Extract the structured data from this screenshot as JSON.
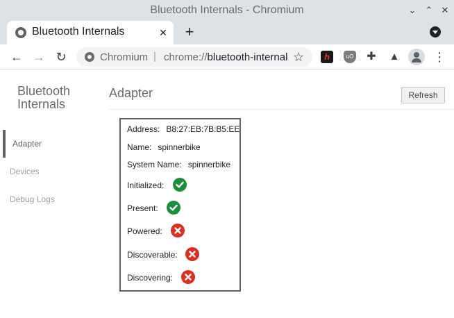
{
  "window": {
    "title": "Bluetooth Internals - Chromium"
  },
  "tab": {
    "title": "Bluetooth Internals"
  },
  "omnibox": {
    "origin": "Chromium",
    "separator": "|",
    "scheme": "chrome://",
    "url_rest": "bluetooth-internal..."
  },
  "extensions": {
    "h_label": "h",
    "ub_label": "uO"
  },
  "sidebar": {
    "title": "Bluetooth Internals",
    "items": [
      {
        "label": "Adapter",
        "selected": true
      },
      {
        "label": "Devices",
        "selected": false
      },
      {
        "label": "Debug Logs",
        "selected": false
      }
    ]
  },
  "main": {
    "heading": "Adapter",
    "refresh_label": "Refresh"
  },
  "adapter": {
    "address_label": "Address:",
    "address_value": "B8:27:EB:7B:B5:EE",
    "name_label": "Name:",
    "name_value": "spinnerbike",
    "system_name_label": "System Name:",
    "system_name_value": "spinnerbike",
    "flags": [
      {
        "label": "Initialized:",
        "value": true
      },
      {
        "label": "Present:",
        "value": true
      },
      {
        "label": "Powered:",
        "value": false
      },
      {
        "label": "Discoverable:",
        "value": false
      },
      {
        "label": "Discovering:",
        "value": false
      }
    ]
  },
  "colors": {
    "ok": "#1e8e3e",
    "bad": "#d93025"
  }
}
